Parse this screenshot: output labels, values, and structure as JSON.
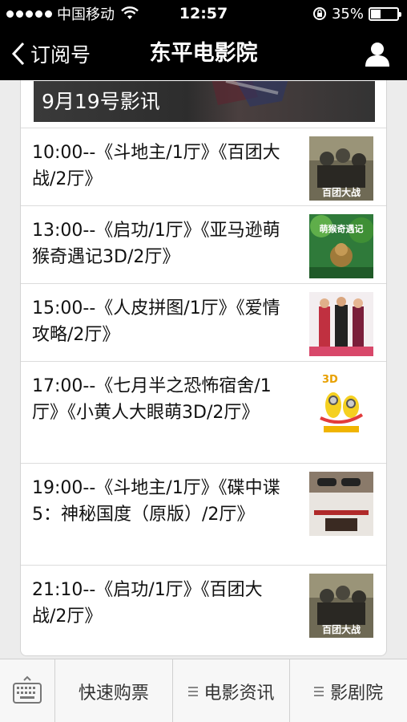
{
  "status_bar": {
    "carrier": "中国移动",
    "time": "12:57",
    "battery": "35%",
    "battery_level": 0.35,
    "icons": [
      "signal-dots-icon",
      "wifi-icon",
      "rotation-lock-icon",
      "battery-icon"
    ]
  },
  "nav": {
    "back_label": "订阅号",
    "title": "东平电影院",
    "icons": [
      "back-chevron-icon",
      "profile-icon"
    ]
  },
  "banner": {
    "title": "9月19号影讯"
  },
  "schedule": [
    {
      "text": "10:00--《斗地主/1厅》《百团大战/2厅》",
      "poster": "百团大战"
    },
    {
      "text": "13:00--《启功/1厅》《亚马逊萌猴奇遇记3D/2厅》",
      "poster": "萌猴奇遇记"
    },
    {
      "text": "15:00--《人皮拼图/1厅》《爱情攻略/2厅》",
      "poster": ""
    },
    {
      "text": "17:00--《七月半之恐怖宿舍/1厅》《小黄人大眼萌3D/2厅》",
      "poster": "3D"
    },
    {
      "text": "19:00--《斗地主/1厅》《碟中谍5：神秘国度（原版）/2厅》",
      "poster": ""
    },
    {
      "text": "21:10--《启功/1厅》《百团大战/2厅》",
      "poster": "百团大战"
    }
  ],
  "bottom_bar": {
    "keyboard_icon": "keyboard-icon",
    "tabs": [
      "快速购票",
      "电影资讯",
      "影剧院"
    ],
    "menu_icon": "menu-lines-icon"
  }
}
